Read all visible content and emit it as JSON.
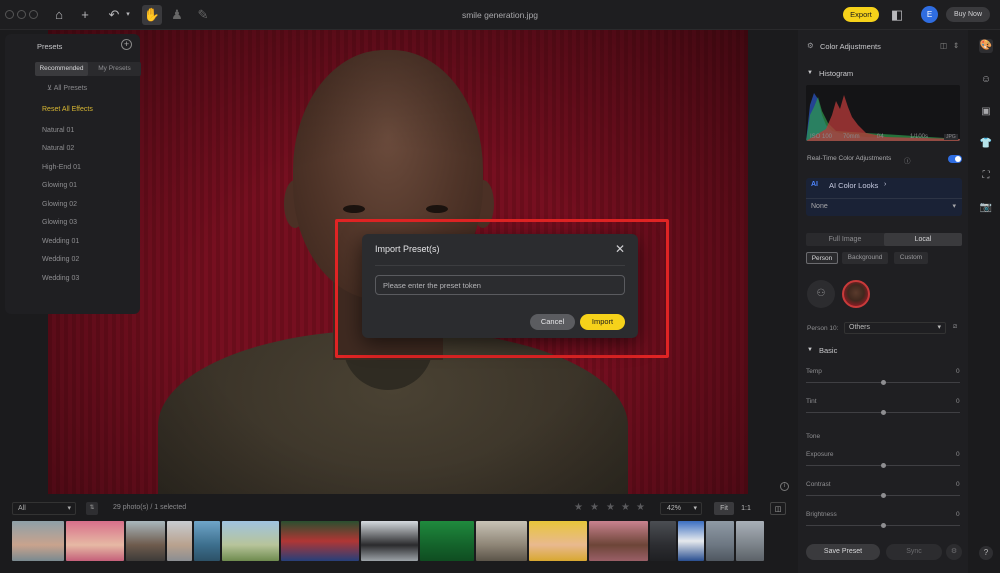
{
  "topbar": {
    "title": "smile generation.jpg",
    "export_label": "Export",
    "avatar_initial": "E",
    "buy_now_label": "Buy Now"
  },
  "presets_panel": {
    "title": "Presets",
    "tabs": [
      "Recommended",
      "My Presets"
    ],
    "filter_label": "All Presets",
    "reset_label": "Reset All Effects",
    "items": [
      "Natural 01",
      "Natural 02",
      "High-End 01",
      "Glowing 01",
      "Glowing 02",
      "Glowing 03",
      "Wedding 01",
      "Wedding 02",
      "Wedding 03"
    ]
  },
  "modal": {
    "title": "Import Preset(s)",
    "token_placeholder": "Please enter the preset token",
    "cancel_label": "Cancel",
    "import_label": "Import"
  },
  "filmstrip": {
    "filter_value": "All",
    "count_text": "29 photo(s) / 1 selected",
    "zoom_value": "42%",
    "fit_label": "Fit",
    "one_to_one_label": "1:1"
  },
  "right_panel": {
    "title": "Color Adjustments",
    "histogram_label": "Histogram",
    "meta": {
      "iso": "ISO 100",
      "focal": "70mm",
      "aperture": "f/4",
      "shutter": "1/100s",
      "format": "JPG"
    },
    "realtime_label": "Real-Time Color Adjustments",
    "realtime_on": true,
    "ai_badge": "AI",
    "ai_looks_label": "AI Color Looks",
    "ai_looks_value": "None",
    "scope_tabs": [
      "Full Image",
      "Local"
    ],
    "scope_selected": "Local",
    "chips": [
      "Person",
      "Background",
      "Custom"
    ],
    "person_label": "Person 10:",
    "person_value": "Others",
    "basic_label": "Basic",
    "tone_label": "Tone",
    "sliders": [
      {
        "label": "Temp",
        "value": "0"
      },
      {
        "label": "Tint",
        "value": "0"
      },
      {
        "label": "Exposure",
        "value": "0"
      },
      {
        "label": "Contrast",
        "value": "0"
      },
      {
        "label": "Brightness",
        "value": "0"
      }
    ],
    "save_preset_label": "Save Preset",
    "sync_label": "Sync"
  },
  "colors": {
    "accent_yellow": "#f6d21a",
    "highlight_red": "#e02424",
    "toggle_blue": "#2f6de1"
  }
}
